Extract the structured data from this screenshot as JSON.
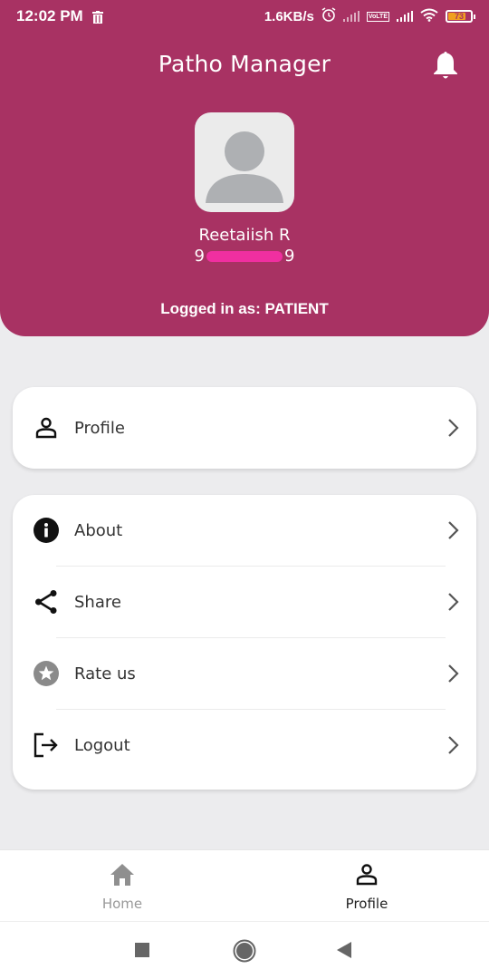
{
  "status_bar": {
    "time": "12:02 PM",
    "net_speed": "1.6KB/s",
    "volte_label": "Vo LTE",
    "battery_level": "73",
    "battery_percent": 73
  },
  "header": {
    "title": "Patho Manager",
    "user_name": "Reetaiish R",
    "phone_prefix": "9",
    "phone_suffix": "9",
    "logged_in_text": "Logged in as: PATIENT",
    "color": "#a83263"
  },
  "menu": {
    "profile_label": "Profile",
    "items": [
      {
        "label": "About",
        "icon": "info-icon"
      },
      {
        "label": "Share",
        "icon": "share-icon"
      },
      {
        "label": "Rate us",
        "icon": "star-icon"
      },
      {
        "label": "Logout",
        "icon": "logout-icon"
      }
    ]
  },
  "bottom_nav": {
    "items": [
      {
        "label": "Home",
        "icon": "home-icon",
        "active": false
      },
      {
        "label": "Profile",
        "icon": "person-icon",
        "active": true
      }
    ]
  }
}
